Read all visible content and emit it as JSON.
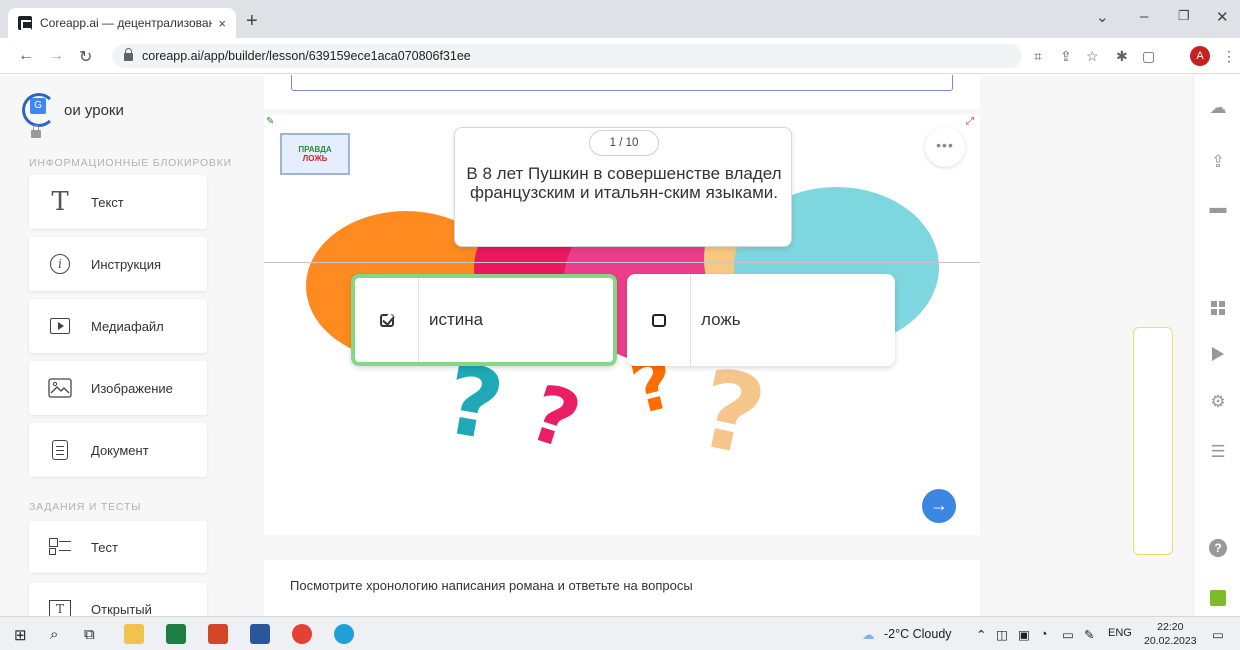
{
  "browser": {
    "tab_title": "Coreapp.ai — децентрализован",
    "tab_close": "×",
    "new_tab": "+",
    "url": "coreapp.ai/app/builder/lesson/639159ece1aca070806f31ee",
    "avatar_letter": "A"
  },
  "sidebar": {
    "brand_text": "ои уроки",
    "section_info": "ИНФОРМАЦИОННЫЕ БЛОКИРОВКИ",
    "info_blocks": [
      {
        "label": "Текст",
        "icon": "text-T-icon"
      },
      {
        "label": "Инструкция",
        "icon": "info-icon"
      },
      {
        "label": "Медиафайл",
        "icon": "media-play-icon"
      },
      {
        "label": "Изображение",
        "icon": "image-icon"
      },
      {
        "label": "Документ",
        "icon": "document-icon"
      }
    ],
    "section_tasks": "ЗАДАНИЯ И ТЕСТЫ",
    "task_blocks": [
      {
        "label": "Тест",
        "icon": "test-checklist-icon"
      },
      {
        "label": "Открытый",
        "icon": "open-question-icon"
      }
    ]
  },
  "quiz": {
    "counter": "1 / 10",
    "question": "В 8 лет Пушкин в совершенстве владел французским и итальян-ским языками.",
    "answers": [
      {
        "label": "истина",
        "selected": true
      },
      {
        "label": "ложь",
        "selected": false
      }
    ],
    "badge_line1": "ПРАВДА",
    "badge_line2": "ЛОЖЬ",
    "more": "•••",
    "next": "→"
  },
  "next_card": {
    "text": "Посмотрите хронологию написания романа и ответьте на вопросы"
  },
  "taskbar": {
    "weather": "-2°C  Cloudy",
    "lang": "ENG",
    "time": "22:20",
    "date": "20.02.2023"
  },
  "colors": {
    "selected_border": "#86d687",
    "next_button": "#3b86e0",
    "brand_blue": "#2f64c6"
  }
}
